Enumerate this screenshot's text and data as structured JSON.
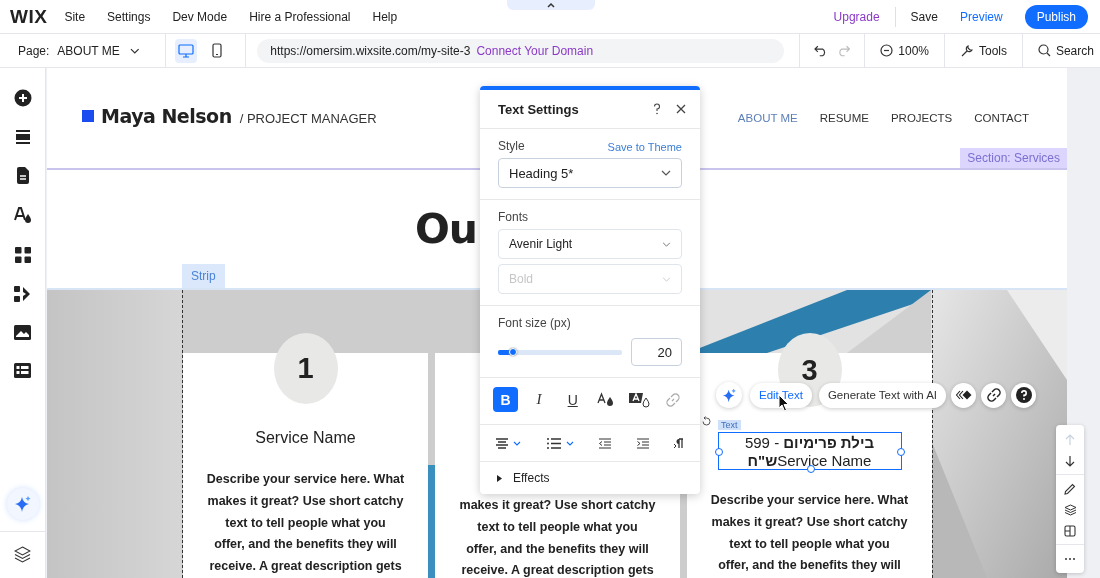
{
  "top_bar": {
    "logo": "WIX",
    "menu": [
      "Site",
      "Settings",
      "Dev Mode",
      "Hire a Professional",
      "Help"
    ],
    "upgrade": "Upgrade",
    "save": "Save",
    "preview": "Preview",
    "publish": "Publish"
  },
  "address_bar": {
    "page_label": "Page:",
    "page": "ABOUT ME",
    "views": [
      {
        "kind": "desktop",
        "selected": true
      },
      {
        "kind": "mobile",
        "selected": false
      }
    ],
    "url": "https://omersim.wixsite.com/my-site-3",
    "connect_link": "Connect Your Domain",
    "zoom": "100%",
    "tools": "Tools",
    "search": "Search"
  },
  "sidebar": {
    "items": [
      {
        "kind": "add"
      },
      {
        "kind": "sections"
      },
      {
        "kind": "pages"
      },
      {
        "kind": "design"
      },
      {
        "kind": "apps"
      },
      {
        "kind": "business"
      },
      {
        "kind": "media"
      },
      {
        "kind": "cms"
      }
    ]
  },
  "site": {
    "brand": "Maya Nelson",
    "tagline": "/ PROJECT MANAGER",
    "nav": [
      {
        "label": "ABOUT ME",
        "selected": true
      },
      {
        "label": "RESUME",
        "selected": false
      },
      {
        "label": "PROJECTS",
        "selected": false
      },
      {
        "label": "CONTACT",
        "selected": false
      }
    ],
    "section_label": "Section: Services",
    "title": "Ou",
    "strip_label": "Strip",
    "cards": [
      {
        "number": "1",
        "heading": "Service Name",
        "description": "Describe your service here. What\nmakes it great? Use short catchy\ntext to tell people what you\noffer, and the benefits they will\nreceive. A great description gets"
      },
      {
        "description": "makes it great? Use short catchy\ntext to tell people what you\noffer, and the benefits they will\nreceive. A great description gets"
      },
      {
        "number": "3",
        "selected": true,
        "element_label": "Text",
        "heading_lines": [
          "**בילת פרימיום** - 599",
          "**ש\"ח**Service Name"
        ],
        "description": "Describe your service here. What\nmakes it great? Use short catchy\ntext to tell people what you\noffer, and the benefits they will"
      }
    ]
  },
  "element_toolbar": {
    "edit": "Edit Text",
    "generate": "Generate Text with AI",
    "icon_buttons": [
      {
        "kind": "animation"
      },
      {
        "kind": "link"
      },
      {
        "kind": "help"
      }
    ]
  },
  "right_toolbar": {
    "items": [
      {
        "kind": "up",
        "disabled": true
      },
      {
        "kind": "down",
        "disabled": false
      },
      {
        "kind": "edit",
        "disabled": false
      },
      {
        "kind": "layers",
        "disabled": false
      },
      {
        "kind": "layout",
        "disabled": false
      },
      {
        "kind": "more",
        "disabled": false
      }
    ]
  },
  "text_settings": {
    "title": "Text Settings",
    "style_label": "Style",
    "save_to_theme": "Save to Theme",
    "style": "Heading 5*",
    "fonts_label": "Fonts",
    "font": "Avenir Light",
    "weight": {
      "value": "Bold",
      "disabled": true
    },
    "size_label": "Font size (px)",
    "size": {
      "level": 0.12,
      "value": "20"
    },
    "format_buttons": [
      {
        "kind": "bold",
        "glyph": "B",
        "selected": true,
        "disabled": false
      },
      {
        "kind": "italic",
        "glyph": "I",
        "selected": false,
        "disabled": false
      },
      {
        "kind": "underline",
        "glyph": "U",
        "selected": false,
        "disabled": false
      },
      {
        "kind": "text-color",
        "selected": false,
        "disabled": false
      },
      {
        "kind": "highlight",
        "selected": false,
        "disabled": false
      },
      {
        "kind": "link",
        "selected": false,
        "disabled": true
      }
    ],
    "paragraph_buttons": [
      {
        "kind": "align",
        "dropdown": true
      },
      {
        "kind": "list",
        "dropdown": true
      },
      {
        "kind": "outdent",
        "dropdown": false
      },
      {
        "kind": "indent",
        "dropdown": false
      },
      {
        "kind": "rtl",
        "dropdown": false
      }
    ],
    "effects": {
      "label": "Effects",
      "expanded": false
    }
  }
}
